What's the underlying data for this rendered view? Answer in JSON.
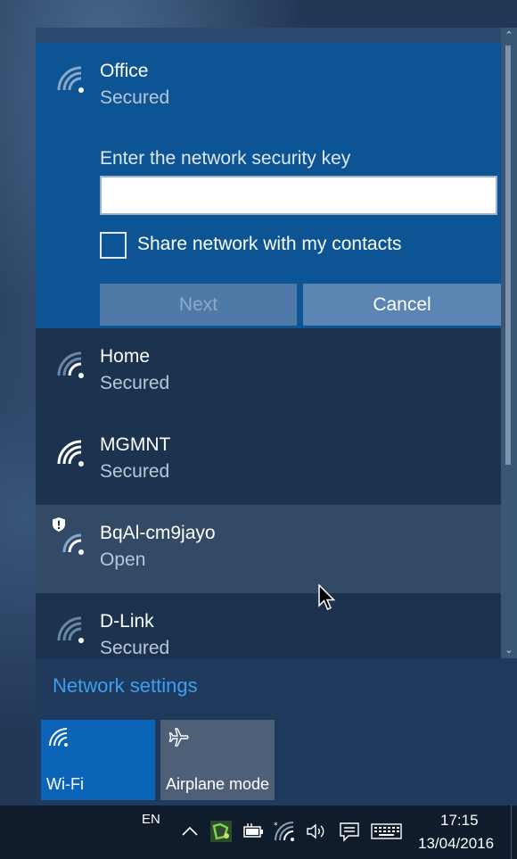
{
  "networks": {
    "expanded": {
      "name": "Office",
      "status": "Secured",
      "key_label": "Enter the network security key",
      "key_value": "",
      "share_label": "Share network with my contacts",
      "next_label": "Next",
      "cancel_label": "Cancel"
    },
    "list": [
      {
        "name": "Home",
        "status": "Secured",
        "signal": "wifi-2-bars-icon"
      },
      {
        "name": "MGMNT",
        "status": "Secured",
        "signal": "wifi-full-icon"
      },
      {
        "name": "BqAl-cm9jayo",
        "status": "Open",
        "signal": "wifi-unsecured-shield-icon"
      },
      {
        "name": "D-Link",
        "status": "Secured",
        "signal": "wifi-2-bars-icon"
      }
    ]
  },
  "network_settings_label": "Network settings",
  "quick_actions": {
    "wifi_label": "Wi-Fi",
    "airplane_label": "Airplane mode"
  },
  "taskbar": {
    "language": "EN",
    "time": "17:15",
    "date": "13/04/2016"
  },
  "colors": {
    "accent": "#0c64b8",
    "link": "#3aa0f0",
    "flyout": "#1f3a5c"
  }
}
